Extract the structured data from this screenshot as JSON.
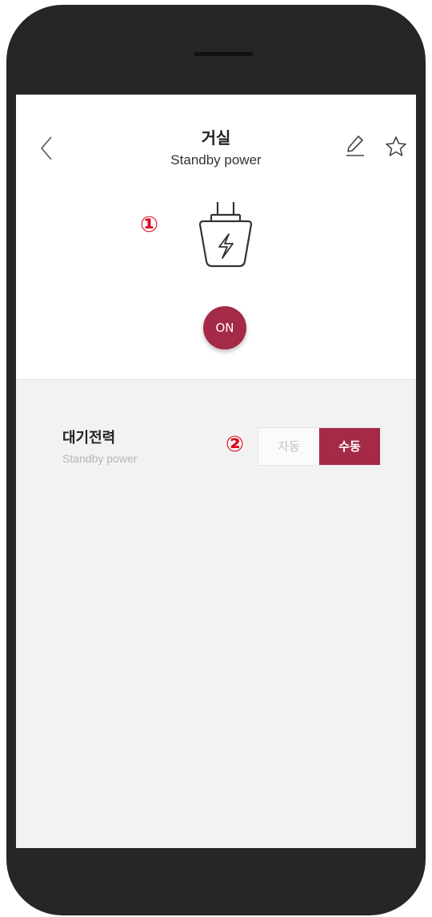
{
  "header": {
    "title": "거실",
    "subtitle": "Standby power",
    "back_icon": "chevron-left-icon",
    "edit_icon": "pencil-icon",
    "favorite_icon": "star-outline-icon"
  },
  "device": {
    "icon": "plug-icon",
    "power_label": "ON",
    "power_color": "#a42a47"
  },
  "annotations": {
    "marker_1": "①",
    "marker_2": "②",
    "marker_color": "#e0001a"
  },
  "standby": {
    "label": "대기전력",
    "sublabel": "Standby power",
    "options": [
      "자동",
      "수동"
    ],
    "selected": "수동"
  }
}
